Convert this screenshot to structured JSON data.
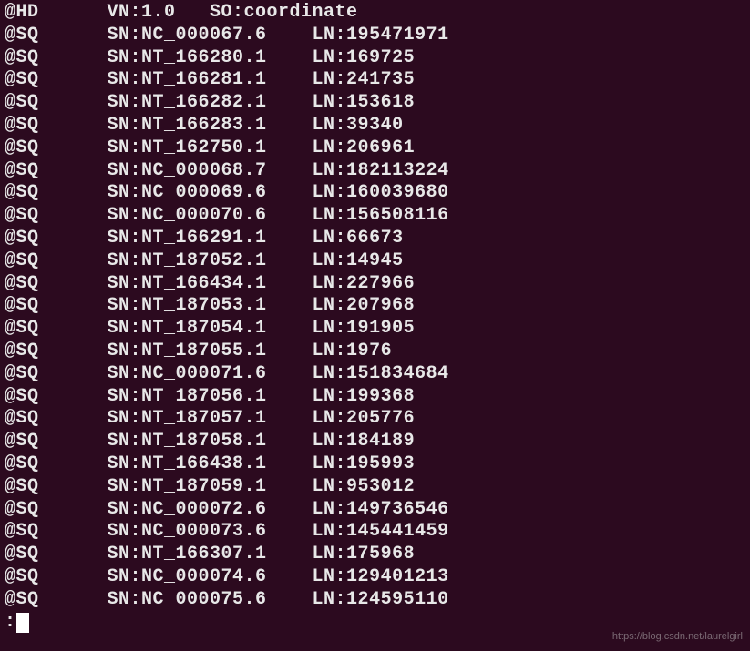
{
  "header": {
    "tag": "@HD",
    "vn": "VN:1.0",
    "so": "SO:coordinate"
  },
  "sequences": [
    {
      "tag": "@SQ",
      "sn": "SN:NC_000067.6",
      "ln": "LN:195471971"
    },
    {
      "tag": "@SQ",
      "sn": "SN:NT_166280.1",
      "ln": "LN:169725"
    },
    {
      "tag": "@SQ",
      "sn": "SN:NT_166281.1",
      "ln": "LN:241735"
    },
    {
      "tag": "@SQ",
      "sn": "SN:NT_166282.1",
      "ln": "LN:153618"
    },
    {
      "tag": "@SQ",
      "sn": "SN:NT_166283.1",
      "ln": "LN:39340"
    },
    {
      "tag": "@SQ",
      "sn": "SN:NT_162750.1",
      "ln": "LN:206961"
    },
    {
      "tag": "@SQ",
      "sn": "SN:NC_000068.7",
      "ln": "LN:182113224"
    },
    {
      "tag": "@SQ",
      "sn": "SN:NC_000069.6",
      "ln": "LN:160039680"
    },
    {
      "tag": "@SQ",
      "sn": "SN:NC_000070.6",
      "ln": "LN:156508116"
    },
    {
      "tag": "@SQ",
      "sn": "SN:NT_166291.1",
      "ln": "LN:66673"
    },
    {
      "tag": "@SQ",
      "sn": "SN:NT_187052.1",
      "ln": "LN:14945"
    },
    {
      "tag": "@SQ",
      "sn": "SN:NT_166434.1",
      "ln": "LN:227966"
    },
    {
      "tag": "@SQ",
      "sn": "SN:NT_187053.1",
      "ln": "LN:207968"
    },
    {
      "tag": "@SQ",
      "sn": "SN:NT_187054.1",
      "ln": "LN:191905"
    },
    {
      "tag": "@SQ",
      "sn": "SN:NT_187055.1",
      "ln": "LN:1976"
    },
    {
      "tag": "@SQ",
      "sn": "SN:NC_000071.6",
      "ln": "LN:151834684"
    },
    {
      "tag": "@SQ",
      "sn": "SN:NT_187056.1",
      "ln": "LN:199368"
    },
    {
      "tag": "@SQ",
      "sn": "SN:NT_187057.1",
      "ln": "LN:205776"
    },
    {
      "tag": "@SQ",
      "sn": "SN:NT_187058.1",
      "ln": "LN:184189"
    },
    {
      "tag": "@SQ",
      "sn": "SN:NT_166438.1",
      "ln": "LN:195993"
    },
    {
      "tag": "@SQ",
      "sn": "SN:NT_187059.1",
      "ln": "LN:953012"
    },
    {
      "tag": "@SQ",
      "sn": "SN:NC_000072.6",
      "ln": "LN:149736546"
    },
    {
      "tag": "@SQ",
      "sn": "SN:NC_000073.6",
      "ln": "LN:145441459"
    },
    {
      "tag": "@SQ",
      "sn": "SN:NT_166307.1",
      "ln": "LN:175968"
    },
    {
      "tag": "@SQ",
      "sn": "SN:NC_000074.6",
      "ln": "LN:129401213"
    },
    {
      "tag": "@SQ",
      "sn": "SN:NC_000075.6",
      "ln": "LN:124595110"
    }
  ],
  "prompt": ":",
  "watermark": "https://blog.csdn.net/laurelgirl"
}
